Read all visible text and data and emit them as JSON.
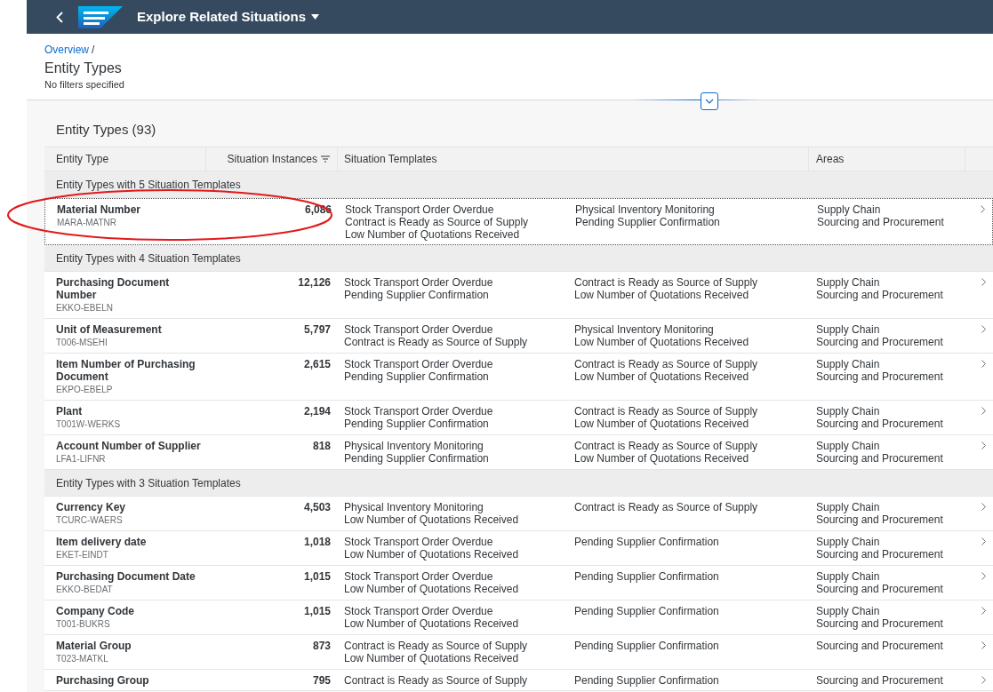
{
  "shell": {
    "title": "Explore Related Situations"
  },
  "breadcrumb": {
    "link": "Overview",
    "separator": "/"
  },
  "header": {
    "title": "Entity Types",
    "subtitle": "No filters specified"
  },
  "table": {
    "title": "Entity Types (93)",
    "columns": [
      "Entity Type",
      "Situation Instances",
      "Situation Templates",
      "Areas"
    ],
    "groups": [
      {
        "label": "Entity Types with 5 Situation Templates",
        "rows": [
          {
            "name": "Material Number",
            "code": "MARA-MATNR",
            "count": "6,086",
            "focused": true,
            "annotated": true,
            "templates": [
              [
                "Stock Transport Order Overdue",
                "Contract is Ready as Source of Supply",
                "Low Number of Quotations Received"
              ],
              [
                "Physical Inventory Monitoring",
                "Pending Supplier Confirmation"
              ]
            ],
            "areas": [
              "Supply Chain",
              "Sourcing and Procurement"
            ]
          }
        ]
      },
      {
        "label": "Entity Types with 4 Situation Templates",
        "rows": [
          {
            "name": "Purchasing Document Number",
            "code": "EKKO-EBELN",
            "count": "12,126",
            "focused": false,
            "annotated": false,
            "templates": [
              [
                "Stock Transport Order Overdue",
                "Pending Supplier Confirmation"
              ],
              [
                "Contract is Ready as Source of Supply",
                "Low Number of Quotations Received"
              ]
            ],
            "areas": [
              "Supply Chain",
              "Sourcing and Procurement"
            ]
          },
          {
            "name": "Unit of Measurement",
            "code": "T006-MSEHI",
            "count": "5,797",
            "focused": false,
            "annotated": false,
            "templates": [
              [
                "Stock Transport Order Overdue",
                "Contract is Ready as Source of Supply"
              ],
              [
                "Physical Inventory Monitoring",
                "Low Number of Quotations Received"
              ]
            ],
            "areas": [
              "Supply Chain",
              "Sourcing and Procurement"
            ]
          },
          {
            "name": "Item Number of Purchasing Document",
            "code": "EKPO-EBELP",
            "count": "2,615",
            "focused": false,
            "annotated": false,
            "templates": [
              [
                "Stock Transport Order Overdue",
                "Pending Supplier Confirmation"
              ],
              [
                "Contract is Ready as Source of Supply",
                "Low Number of Quotations Received"
              ]
            ],
            "areas": [
              "Supply Chain",
              "Sourcing and Procurement"
            ]
          },
          {
            "name": "Plant",
            "code": "T001W-WERKS",
            "count": "2,194",
            "focused": false,
            "annotated": false,
            "templates": [
              [
                "Stock Transport Order Overdue",
                "Pending Supplier Confirmation"
              ],
              [
                "Contract is Ready as Source of Supply",
                "Low Number of Quotations Received"
              ]
            ],
            "areas": [
              "Supply Chain",
              "Sourcing and Procurement"
            ]
          },
          {
            "name": "Account Number of Supplier",
            "code": "LFA1-LIFNR",
            "count": "818",
            "focused": false,
            "annotated": false,
            "templates": [
              [
                "Physical Inventory Monitoring",
                "Pending Supplier Confirmation"
              ],
              [
                "Contract is Ready as Source of Supply",
                "Low Number of Quotations Received"
              ]
            ],
            "areas": [
              "Supply Chain",
              "Sourcing and Procurement"
            ]
          }
        ]
      },
      {
        "label": "Entity Types with 3 Situation Templates",
        "rows": [
          {
            "name": "Currency Key",
            "code": "TCURC-WAERS",
            "count": "4,503",
            "focused": false,
            "annotated": false,
            "templates": [
              [
                "Physical Inventory Monitoring",
                "Low Number of Quotations Received"
              ],
              [
                "Contract is Ready as Source of Supply"
              ]
            ],
            "areas": [
              "Supply Chain",
              "Sourcing and Procurement"
            ]
          },
          {
            "name": "Item delivery date",
            "code": "EKET-EINDT",
            "count": "1,018",
            "focused": false,
            "annotated": false,
            "templates": [
              [
                "Stock Transport Order Overdue",
                "Low Number of Quotations Received"
              ],
              [
                "Pending Supplier Confirmation"
              ]
            ],
            "areas": [
              "Supply Chain",
              "Sourcing and Procurement"
            ]
          },
          {
            "name": "Purchasing Document Date",
            "code": "EKKO-BEDAT",
            "count": "1,015",
            "focused": false,
            "annotated": false,
            "templates": [
              [
                "Stock Transport Order Overdue",
                "Low Number of Quotations Received"
              ],
              [
                "Pending Supplier Confirmation"
              ]
            ],
            "areas": [
              "Supply Chain",
              "Sourcing and Procurement"
            ]
          },
          {
            "name": "Company Code",
            "code": "T001-BUKRS",
            "count": "1,015",
            "focused": false,
            "annotated": false,
            "templates": [
              [
                "Stock Transport Order Overdue",
                "Low Number of Quotations Received"
              ],
              [
                "Pending Supplier Confirmation"
              ]
            ],
            "areas": [
              "Supply Chain",
              "Sourcing and Procurement"
            ]
          },
          {
            "name": "Material Group",
            "code": "T023-MATKL",
            "count": "873",
            "focused": false,
            "annotated": false,
            "templates": [
              [
                "Contract is Ready as Source of Supply",
                "Low Number of Quotations Received"
              ],
              [
                "Pending Supplier Confirmation"
              ]
            ],
            "areas": [
              "Sourcing and Procurement"
            ]
          },
          {
            "name": "Purchasing Group",
            "count": "795",
            "focused": false,
            "annotated": false,
            "templates": [
              [
                "Contract is Ready as Source of Supply"
              ],
              [
                "Pending Supplier Confirmation"
              ]
            ],
            "areas": [
              "Sourcing and Procurement"
            ]
          }
        ]
      }
    ]
  }
}
